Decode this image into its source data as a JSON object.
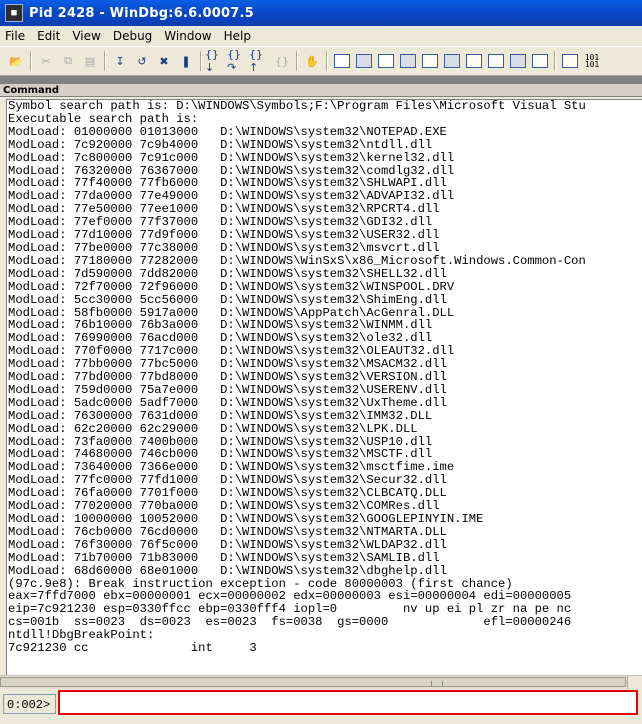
{
  "window": {
    "title": "Pid 2428 - WinDbg:6.6.0007.5",
    "app_icon": "windbg-icon"
  },
  "menu": [
    "File",
    "Edit",
    "View",
    "Debug",
    "Window",
    "Help"
  ],
  "toolbar": {
    "binary_label": "101\n101"
  },
  "command_window": {
    "title": "Command",
    "lines": [
      "Symbol search path is: D:\\WINDOWS\\Symbols;F:\\Program Files\\Microsoft Visual Stu",
      "Executable search path is:",
      "ModLoad: 01000000 01013000   D:\\WINDOWS\\system32\\NOTEPAD.EXE",
      "ModLoad: 7c920000 7c9b4000   D:\\WINDOWS\\system32\\ntdll.dll",
      "ModLoad: 7c800000 7c91c000   D:\\WINDOWS\\system32\\kernel32.dll",
      "ModLoad: 76320000 76367000   D:\\WINDOWS\\system32\\comdlg32.dll",
      "ModLoad: 77f40000 77fb6000   D:\\WINDOWS\\system32\\SHLWAPI.dll",
      "ModLoad: 77da0000 77e49000   D:\\WINDOWS\\system32\\ADVAPI32.dll",
      "ModLoad: 77e50000 77ee1000   D:\\WINDOWS\\system32\\RPCRT4.dll",
      "ModLoad: 77ef0000 77f37000   D:\\WINDOWS\\system32\\GDI32.dll",
      "ModLoad: 77d10000 77d9f000   D:\\WINDOWS\\system32\\USER32.dll",
      "ModLoad: 77be0000 77c38000   D:\\WINDOWS\\system32\\msvcrt.dll",
      "ModLoad: 77180000 77282000   D:\\WINDOWS\\WinSxS\\x86_Microsoft.Windows.Common-Con",
      "ModLoad: 7d590000 7dd82000   D:\\WINDOWS\\system32\\SHELL32.dll",
      "ModLoad: 72f70000 72f96000   D:\\WINDOWS\\system32\\WINSPOOL.DRV",
      "ModLoad: 5cc30000 5cc56000   D:\\WINDOWS\\system32\\ShimEng.dll",
      "ModLoad: 58fb0000 5917a000   D:\\WINDOWS\\AppPatch\\AcGenral.DLL",
      "ModLoad: 76b10000 76b3a000   D:\\WINDOWS\\system32\\WINMM.dll",
      "ModLoad: 76990000 76acd000   D:\\WINDOWS\\system32\\ole32.dll",
      "ModLoad: 770f0000 7717c000   D:\\WINDOWS\\system32\\OLEAUT32.dll",
      "ModLoad: 77bb0000 77bc5000   D:\\WINDOWS\\system32\\MSACM32.dll",
      "ModLoad: 77bd0000 77bd8000   D:\\WINDOWS\\system32\\VERSION.dll",
      "ModLoad: 759d0000 75a7e000   D:\\WINDOWS\\system32\\USERENV.dll",
      "ModLoad: 5adc0000 5adf7000   D:\\WINDOWS\\system32\\UxTheme.dll",
      "ModLoad: 76300000 7631d000   D:\\WINDOWS\\system32\\IMM32.DLL",
      "ModLoad: 62c20000 62c29000   D:\\WINDOWS\\system32\\LPK.DLL",
      "ModLoad: 73fa0000 7400b000   D:\\WINDOWS\\system32\\USP10.dll",
      "ModLoad: 74680000 746cb000   D:\\WINDOWS\\system32\\MSCTF.dll",
      "ModLoad: 73640000 7366e000   D:\\WINDOWS\\system32\\msctfime.ime",
      "ModLoad: 77fc0000 77fd1000   D:\\WINDOWS\\system32\\Secur32.dll",
      "ModLoad: 76fa0000 7701f000   D:\\WINDOWS\\system32\\CLBCATQ.DLL",
      "ModLoad: 77020000 770ba000   D:\\WINDOWS\\system32\\COMRes.dll",
      "ModLoad: 10000000 10052000   D:\\WINDOWS\\system32\\GOOGLEPINYIN.IME",
      "ModLoad: 76cb0000 76cd0000   D:\\WINDOWS\\system32\\NTMARTA.DLL",
      "ModLoad: 76f30000 76f5c000   D:\\WINDOWS\\system32\\WLDAP32.dll",
      "ModLoad: 71b70000 71b83000   D:\\WINDOWS\\system32\\SAMLIB.dll",
      "ModLoad: 68d60000 68e01000   D:\\WINDOWS\\system32\\dbghelp.dll",
      "(97c.9e8): Break instruction exception - code 80000003 (first chance)",
      "eax=7ffd7000 ebx=00000001 ecx=00000002 edx=00000003 esi=00000004 edi=00000005",
      "eip=7c921230 esp=0330ffcc ebp=0330fff4 iopl=0         nv up ei pl zr na pe nc",
      "cs=001b  ss=0023  ds=0023  es=0023  fs=0038  gs=0000             efl=00000246",
      "ntdll!DbgBreakPoint:",
      "7c921230 cc              int     3"
    ]
  },
  "command_input": {
    "prompt": "0:002>",
    "value": ""
  }
}
